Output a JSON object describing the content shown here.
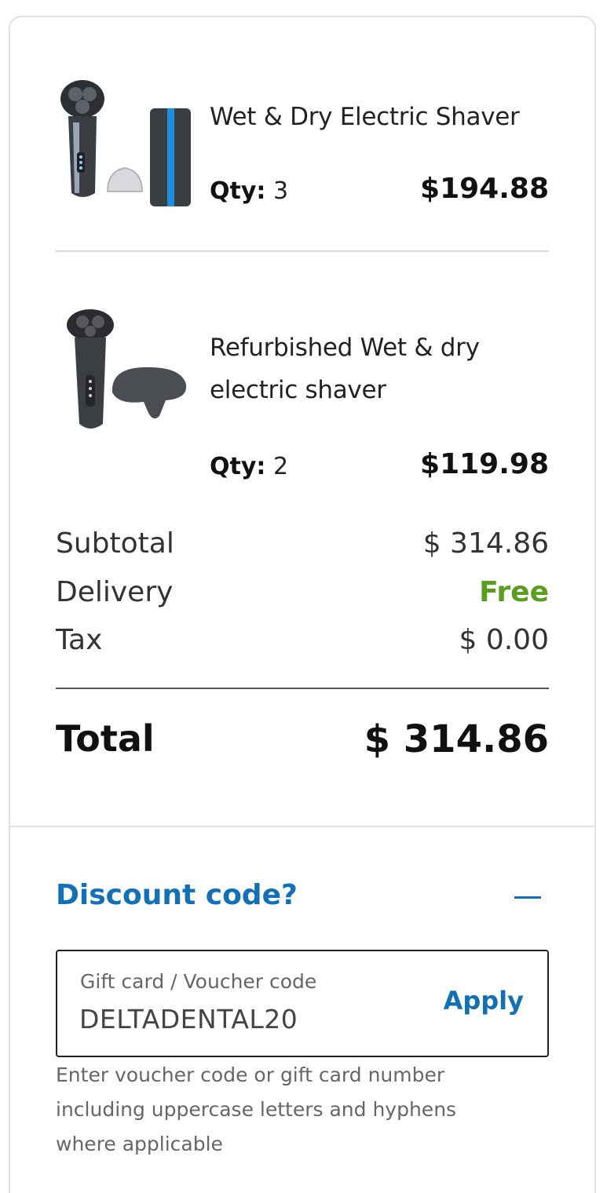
{
  "cart": {
    "items": [
      {
        "name": "Wet & Dry Electric Shaver",
        "qty_label": "Qty:",
        "qty": "3",
        "price": "$194.88",
        "image_icon": "shaver-with-accessories-image"
      },
      {
        "name_line1": "Refurbished Wet & dry",
        "name_line2": "electric shaver",
        "qty_label": "Qty:",
        "qty": "2",
        "price": "$119.98",
        "image_icon": "shaver-with-cover-image"
      }
    ]
  },
  "summary": {
    "subtotal_label": "Subtotal",
    "subtotal_value": "$ 314.86",
    "delivery_label": "Delivery",
    "delivery_value": "Free",
    "tax_label": "Tax",
    "tax_value": "$ 0.00",
    "total_label": "Total",
    "total_value": "$ 314.86"
  },
  "discount": {
    "title": "Discount code?",
    "toggle_icon": "minus-icon",
    "field_label": "Gift card / Voucher code",
    "field_value": "DELTADENTAL20",
    "apply_label": "Apply",
    "help_line1": "Enter voucher code or gift card number",
    "help_line2": "including uppercase letters and hyphens",
    "help_line3": "where applicable"
  },
  "colors": {
    "accent_blue": "#1170b8",
    "free_green": "#5a9e1e"
  }
}
